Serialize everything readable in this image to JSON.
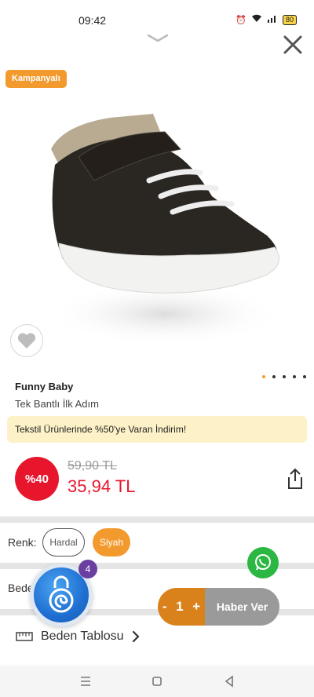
{
  "status_bar": {
    "time": "09:42",
    "battery": "80"
  },
  "product": {
    "badge": "Kampanyalı",
    "brand": "Funny Baby",
    "name": "Tek Bantlı İlk Adım",
    "promo": "Tekstil Ürünlerinde %50'ye Varan İndirim!",
    "discount": "%40",
    "old_price": "59,90 TL",
    "price": "35,94 TL",
    "image_count": 5,
    "active_image": 1
  },
  "options": {
    "color_label": "Renk:",
    "colors": [
      "Hardal",
      "Siyah"
    ],
    "selected_color": "Siyah",
    "size_label": "Beden"
  },
  "widgets": {
    "notification_count": "4"
  },
  "cart": {
    "minus": "-",
    "quantity": "1",
    "plus": "+",
    "notify_label": "Haber Ver"
  },
  "size_chart": {
    "label": "Beden Tablosu"
  },
  "colors": {
    "accent": "#f39a2f",
    "sale": "#e8162d",
    "promo_bg": "#fdf1c7"
  }
}
